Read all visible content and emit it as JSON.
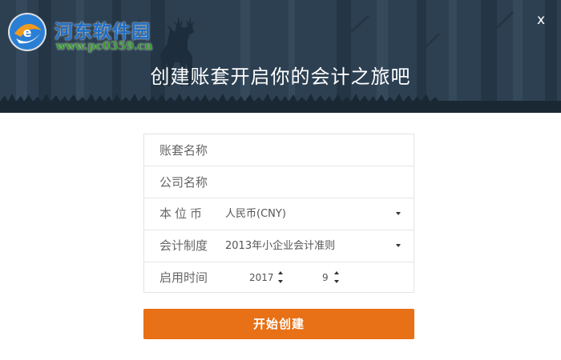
{
  "header": {
    "title": "创建账套开启你的会计之旅吧",
    "close_label": "x"
  },
  "watermark": {
    "name": "河东软件园",
    "url": "www.pc0359.cn"
  },
  "form": {
    "account_name": {
      "placeholder": "账套名称",
      "value": ""
    },
    "company_name": {
      "placeholder": "公司名称",
      "value": ""
    },
    "currency": {
      "label": "本位币",
      "value": "人民币(CNY)",
      "icon": "chevron-down-icon"
    },
    "accounting_system": {
      "label": "会计制度",
      "value": "2013年小企业会计准则",
      "icon": "chevron-down-icon"
    },
    "start_time": {
      "label": "启用时间",
      "year": "2017",
      "month": "9",
      "icon": "spinner-arrows-icon"
    }
  },
  "submit_label": "开始创建",
  "colors": {
    "header_bg": "#2b3d4f",
    "accent": "#e87016",
    "watermark_name": "#1e6fc7",
    "watermark_url": "#3a9a2f"
  }
}
